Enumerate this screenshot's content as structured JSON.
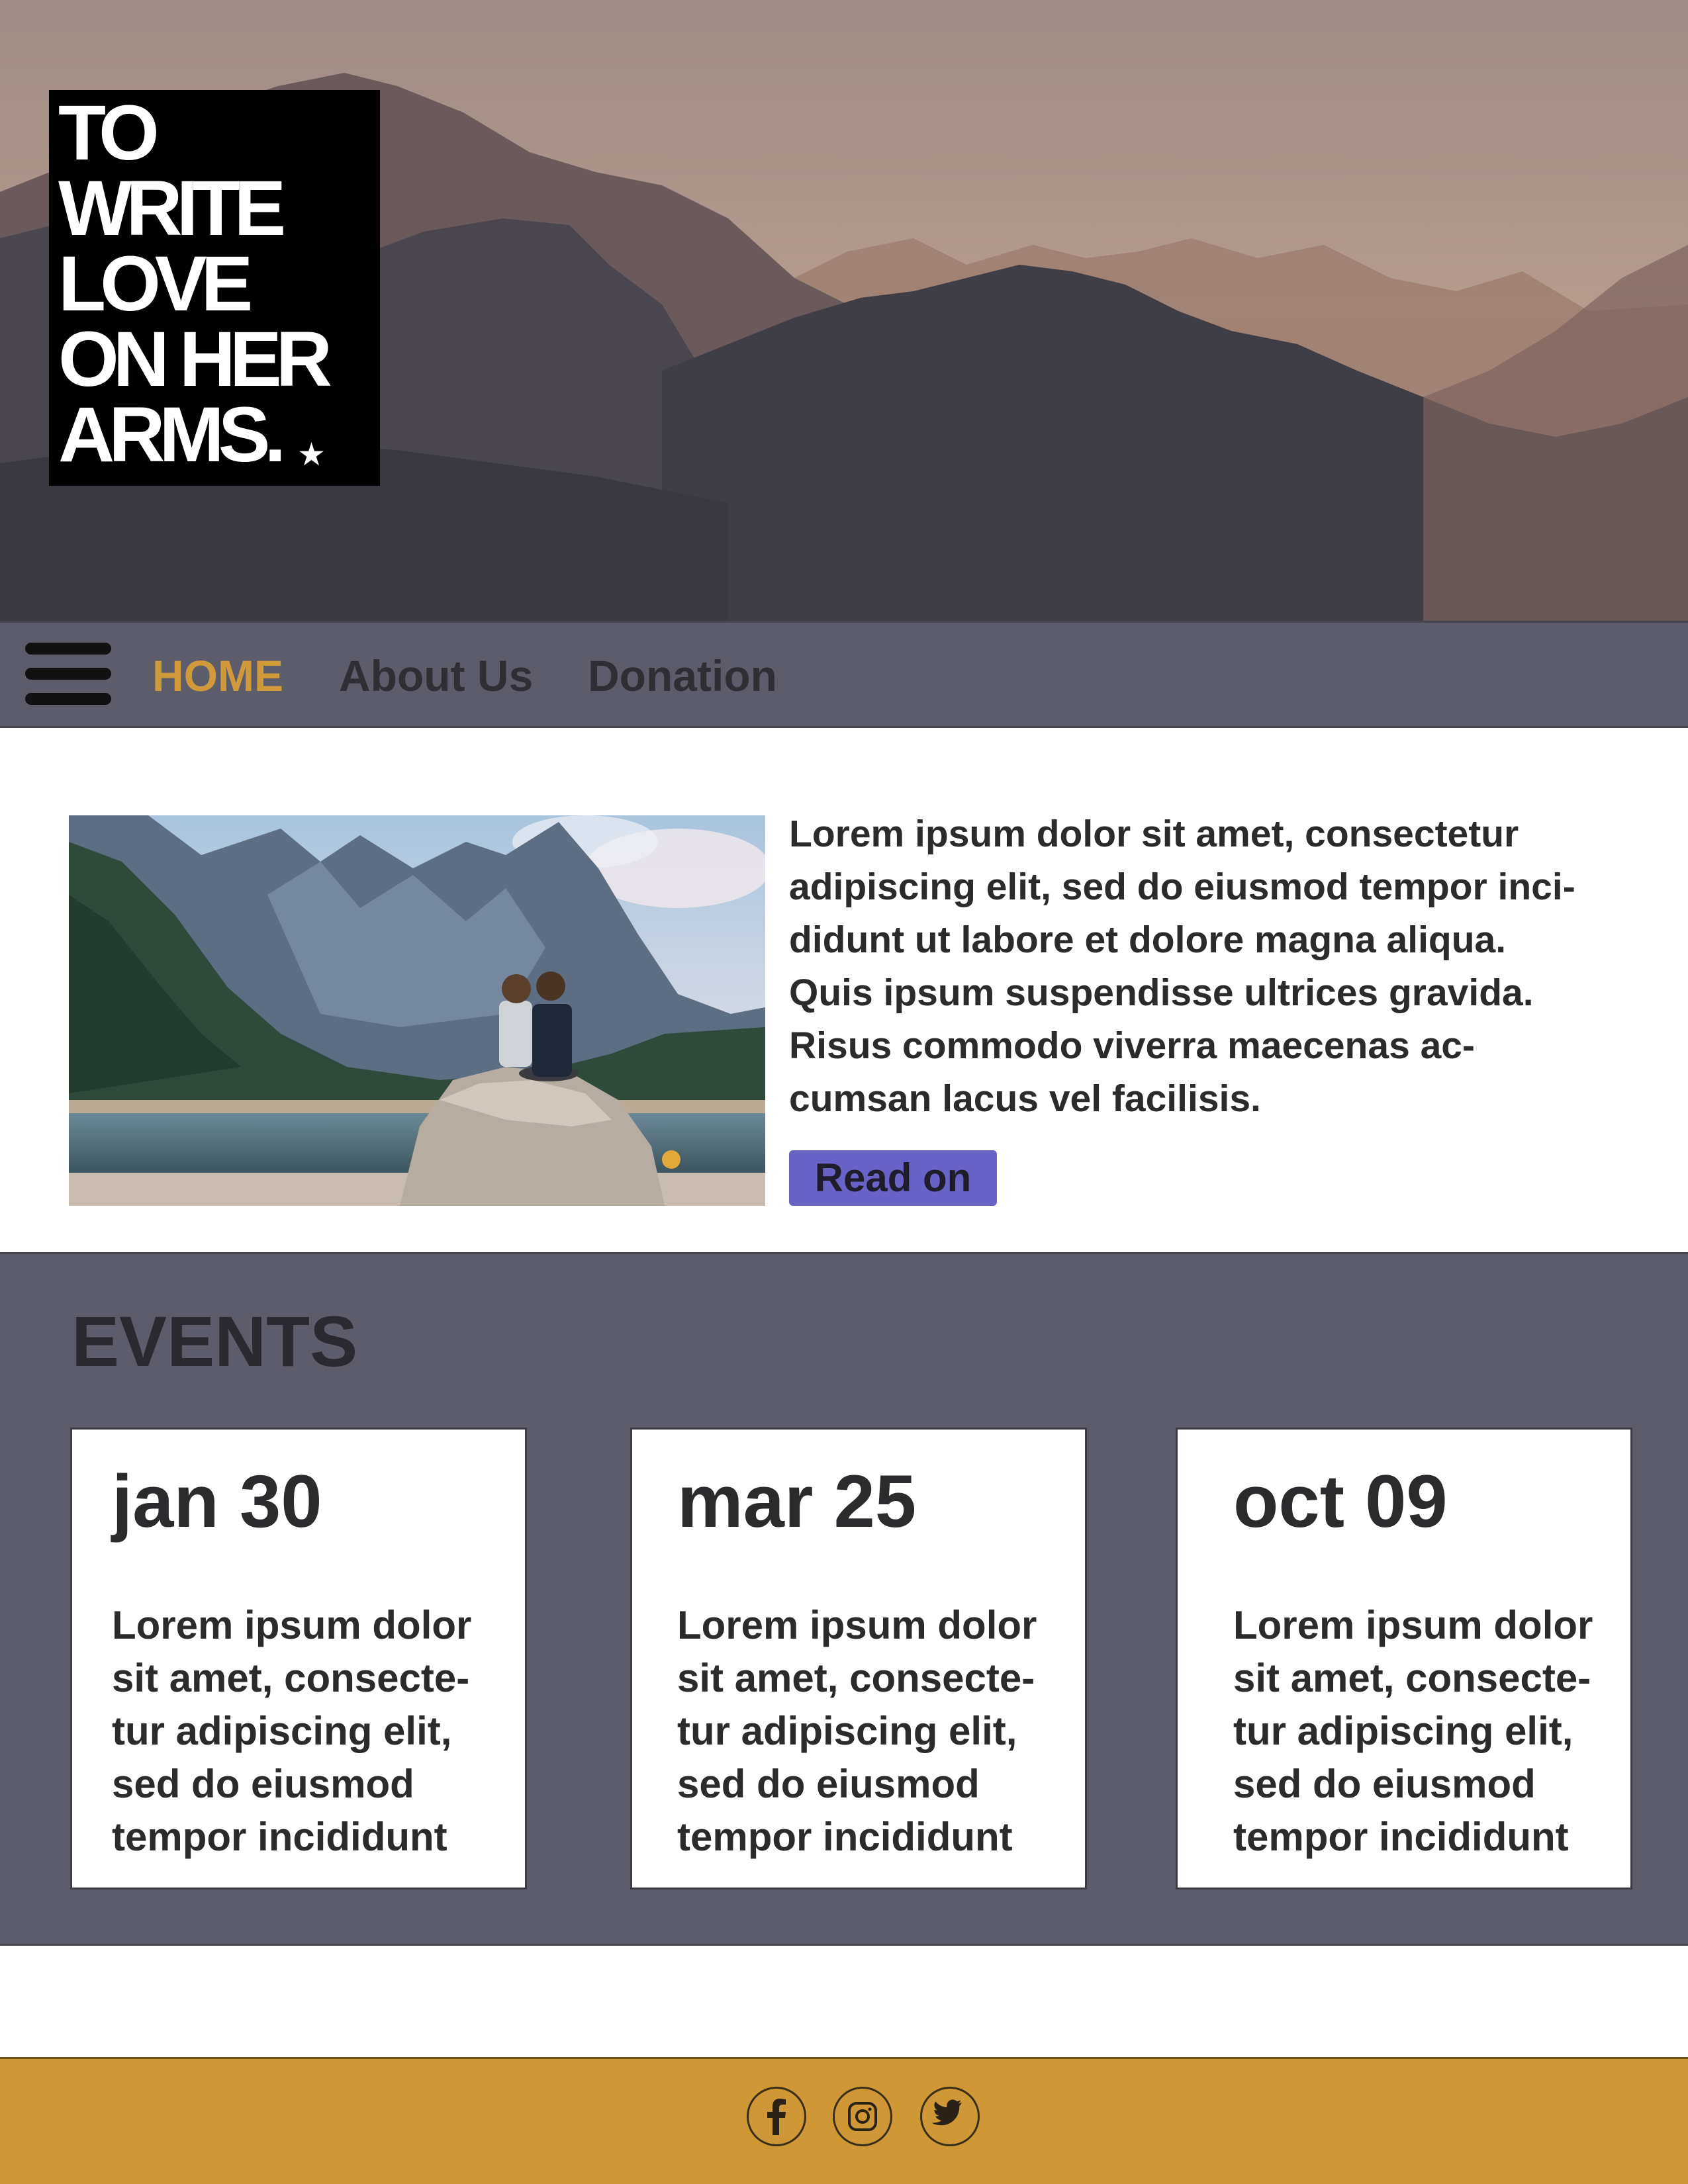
{
  "logo": {
    "lines": [
      "TO",
      "WRITE",
      "LOVE",
      "ON HER",
      "ARMS."
    ],
    "star": "★"
  },
  "nav": {
    "items": [
      {
        "label": "HOME",
        "active": true
      },
      {
        "label": "About Us",
        "active": false
      },
      {
        "label": "Donation",
        "active": false
      }
    ]
  },
  "feature": {
    "text": "Lorem ipsum dolor sit amet, consectetur adipiscing elit, sed do eiusmod tempor inci-didunt ut labore et dolore magna aliqua. Quis ipsum suspendisse ultrices gravida. Risus commodo viverra maecenas ac-cumsan lacus vel facilisis.",
    "lines": [
      "Lorem ipsum dolor sit amet, consectetur",
      "adipiscing elit, sed do eiusmod tempor inci-",
      "didunt ut labore et dolore magna aliqua.",
      "Quis ipsum suspendisse ultrices gravida.",
      "Risus commodo viverra maecenas ac-",
      "cumsan lacus vel facilisis."
    ],
    "button_label": "Read on"
  },
  "events": {
    "title": "EVENTS",
    "cards": [
      {
        "date": "jan 30",
        "lines": [
          "Lorem ipsum dolor",
          "sit amet, consecte-",
          "tur adipiscing elit,",
          "sed do eiusmod",
          "tempor incididunt"
        ]
      },
      {
        "date": "mar 25",
        "lines": [
          "Lorem ipsum dolor",
          "sit amet, consecte-",
          "tur adipiscing elit,",
          "sed do eiusmod",
          "tempor incididunt"
        ]
      },
      {
        "date": "oct 09",
        "lines": [
          "Lorem ipsum dolor",
          "sit amet, consecte-",
          "tur adipiscing elit,",
          "sed do eiusmod",
          "tempor incididunt"
        ]
      }
    ]
  },
  "footer": {
    "social": [
      "facebook-icon",
      "instagram-icon",
      "twitter-icon"
    ]
  },
  "colors": {
    "nav_bg": "#5d5c6b",
    "active_nav": "#d09a3a",
    "button": "#6a63c7",
    "footer_bg": "#cf9735"
  }
}
